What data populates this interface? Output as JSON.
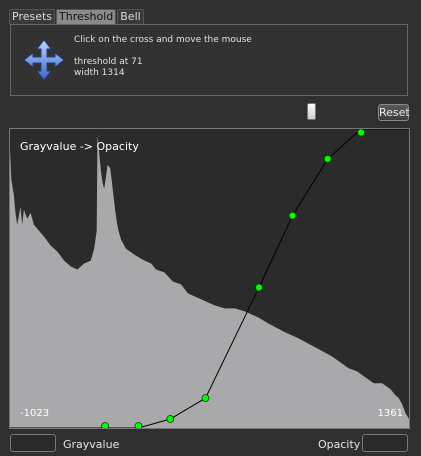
{
  "tabs": [
    {
      "label": "Presets",
      "active": false
    },
    {
      "label": "Threshold",
      "active": true
    },
    {
      "label": "Bell",
      "active": false
    }
  ],
  "info": {
    "instruction": "Click on the cross and move the mouse",
    "threshold_text": "threshold at 71",
    "width_text": "width 1314",
    "icon": "move-cross-icon"
  },
  "controls": {
    "reset_label": "Reset"
  },
  "chart_data": {
    "type": "area",
    "title": "Grayvalue -> Opacity",
    "xlim": [
      -1023,
      1361
    ],
    "ylim": [
      0,
      1
    ],
    "x_min_label": "-1023",
    "x_max_label": "1361",
    "histogram": {
      "color": "#a9a9ab",
      "x": [
        -1023,
        -1015,
        -1000,
        -990,
        -980,
        -960,
        -950,
        -940,
        -920,
        -900,
        -880,
        -850,
        -820,
        -780,
        -740,
        -700,
        -660,
        -620,
        -580,
        -540,
        -520,
        -505,
        -500,
        -490,
        -480,
        -470,
        -460,
        -455,
        -440,
        -425,
        -418,
        -412,
        -405,
        -395,
        -385,
        -375,
        -360,
        -330,
        -280,
        -220,
        -180,
        -150,
        -100,
        -50,
        0,
        40,
        80,
        120,
        160,
        200,
        260,
        320,
        380,
        420,
        460,
        520,
        620,
        700,
        800,
        900,
        1000,
        1050,
        1100,
        1150,
        1200,
        1250,
        1280,
        1300,
        1320,
        1340,
        1361
      ],
      "y": [
        0.93,
        0.83,
        0.78,
        0.72,
        0.68,
        0.74,
        0.68,
        0.73,
        0.7,
        0.72,
        0.68,
        0.66,
        0.64,
        0.61,
        0.59,
        0.56,
        0.54,
        0.53,
        0.55,
        0.56,
        0.6,
        0.66,
        0.98,
        0.92,
        0.86,
        0.82,
        0.8,
        0.82,
        0.88,
        0.87,
        0.84,
        0.81,
        0.78,
        0.73,
        0.69,
        0.66,
        0.63,
        0.6,
        0.58,
        0.56,
        0.55,
        0.53,
        0.52,
        0.49,
        0.48,
        0.45,
        0.44,
        0.43,
        0.42,
        0.41,
        0.4,
        0.4,
        0.39,
        0.38,
        0.37,
        0.35,
        0.32,
        0.3,
        0.27,
        0.24,
        0.2,
        0.19,
        0.17,
        0.15,
        0.15,
        0.13,
        0.11,
        0.1,
        0.08,
        0.05,
        0.03
      ]
    },
    "transfer_function": {
      "color": "#00ff00",
      "points": [
        {
          "x": -455,
          "y": 0.0
        },
        {
          "x": -255,
          "y": 0.0
        },
        {
          "x": -65,
          "y": 0.03
        },
        {
          "x": 145,
          "y": 0.1
        },
        {
          "x": 465,
          "y": 0.47
        },
        {
          "x": 665,
          "y": 0.71
        },
        {
          "x": 875,
          "y": 0.9
        },
        {
          "x": 1075,
          "y": 1.0
        }
      ]
    }
  },
  "bottom": {
    "left_label": "Grayvalue",
    "right_label": "Opacity"
  }
}
